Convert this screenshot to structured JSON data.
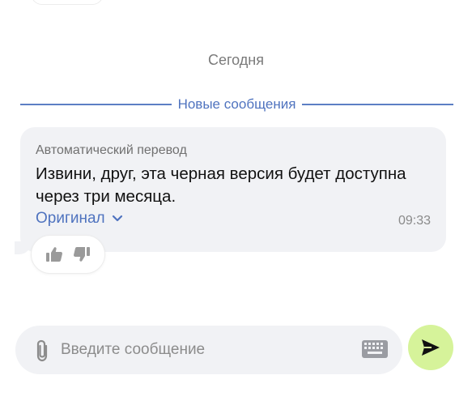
{
  "chat": {
    "date_separator": "Сегодня",
    "new_messages_label": "Новые сообщения"
  },
  "message": {
    "translation_note": "Автоматический перевод",
    "text": "Извини, друг, эта черная версия будет доступна через три месяца.",
    "original_link": "Оригинал",
    "time": "09:33"
  },
  "reactions": {
    "like_icon": "thumbs-up-icon",
    "dislike_icon": "thumbs-down-icon"
  },
  "composer": {
    "placeholder": "Введите сообщение",
    "attach_icon": "paperclip-icon",
    "keyboard_icon": "keyboard-icon",
    "send_icon": "send-arrow-icon"
  },
  "colors": {
    "accent_blue": "#4f73bf",
    "send_button": "#d6f39a",
    "bubble_bg": "#f1f2f5"
  }
}
